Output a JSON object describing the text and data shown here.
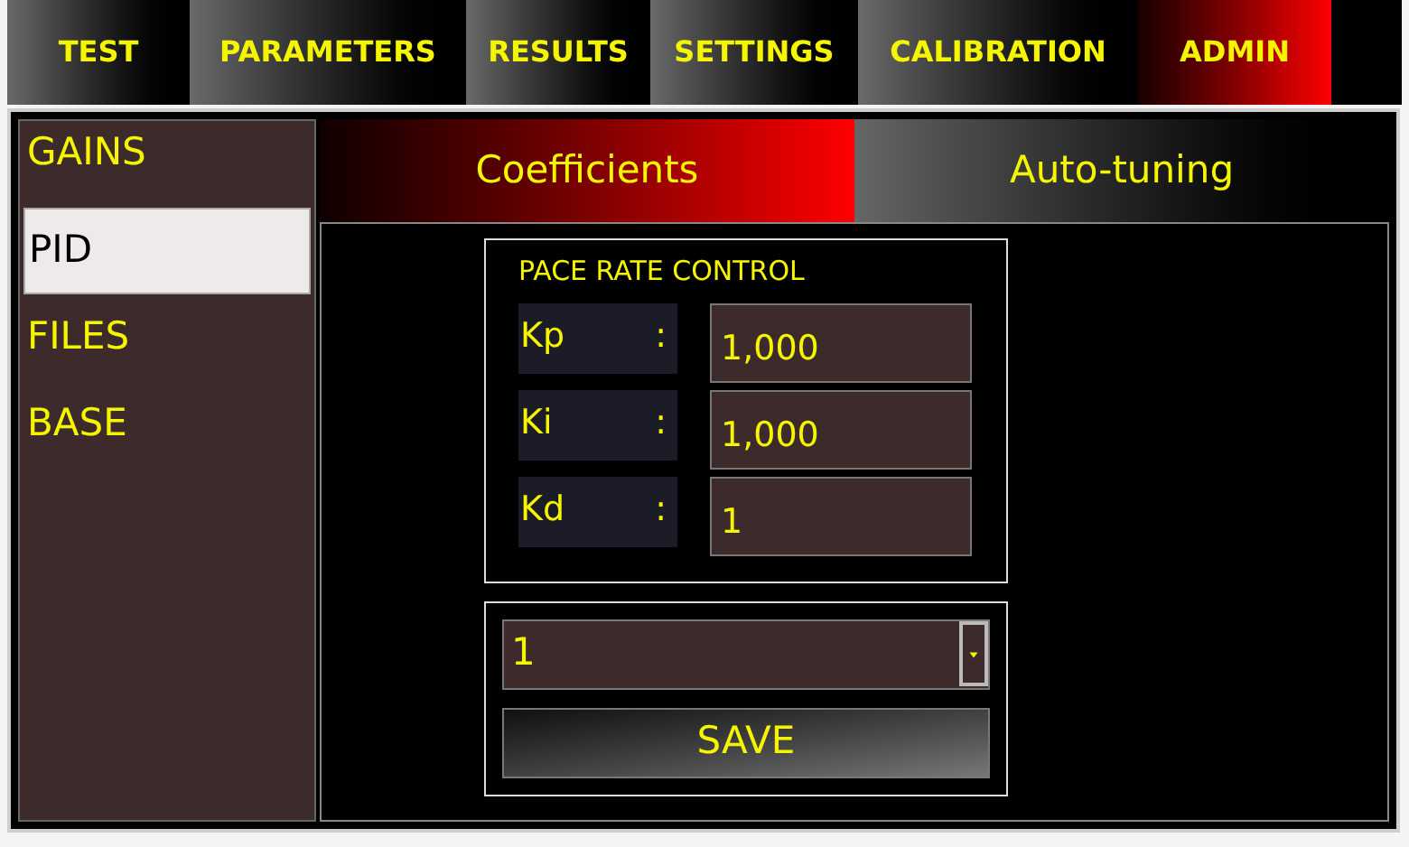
{
  "tabs": [
    {
      "label": "TEST",
      "selected": false
    },
    {
      "label": "PARAMETERS",
      "selected": false
    },
    {
      "label": "RESULTS",
      "selected": false
    },
    {
      "label": "SETTINGS",
      "selected": false
    },
    {
      "label": "CALIBRATION",
      "selected": false
    },
    {
      "label": "ADMIN",
      "selected": true
    }
  ],
  "sidebar": {
    "items": [
      {
        "label": "GAINS",
        "selected": false
      },
      {
        "label": "PID",
        "selected": true
      },
      {
        "label": "FILES",
        "selected": false
      },
      {
        "label": "BASE",
        "selected": false
      }
    ]
  },
  "subtabs": [
    {
      "label": "Coefficients",
      "selected": true
    },
    {
      "label": "Auto-tuning",
      "selected": false
    }
  ],
  "group": {
    "title": "PACE RATE CONTROL",
    "fields": [
      {
        "label": "Kp",
        "separator": ":",
        "value": "1,000"
      },
      {
        "label": "Ki",
        "separator": ":",
        "value": "1,000"
      },
      {
        "label": "Kd",
        "separator": ":",
        "value": "1"
      }
    ]
  },
  "dropdown": {
    "value": "1"
  },
  "save_button": "SAVE"
}
